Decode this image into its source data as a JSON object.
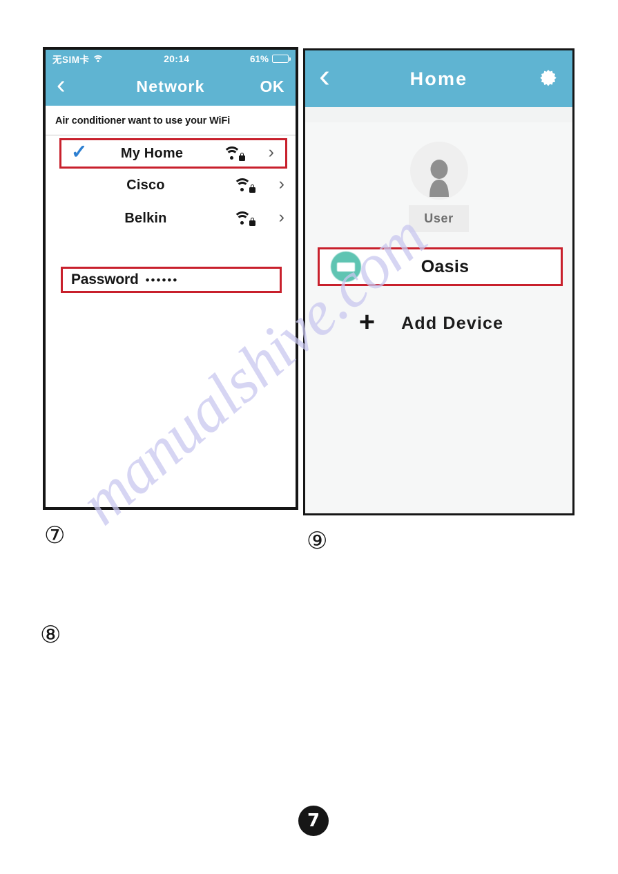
{
  "watermark": {
    "text": "manualshive.com"
  },
  "colors": {
    "header_blue": "#5FB4D2",
    "highlight_red": "#C8202C",
    "check_blue": "#2D7FD1",
    "device_teal": "#5FC4B2",
    "battery_green": "#3FBD46"
  },
  "left_phone": {
    "status_bar": {
      "carrier": "无SIM卡",
      "wifi_icon": "wifi-icon",
      "time": "20:14",
      "battery_percent": "61%",
      "battery_level": 61,
      "battery_icon": "battery-icon"
    },
    "nav": {
      "back_icon": "chevron-left-icon",
      "title": "Network",
      "action_label": "OK"
    },
    "prompt": "Air conditioner want to use your WiFi",
    "networks": [
      {
        "name": "My Home",
        "selected": true,
        "check_icon": "check-icon",
        "signal_icon": "wifi-lock-icon",
        "chevron_icon": "chevron-right-icon",
        "highlighted": true
      },
      {
        "name": "Cisco",
        "selected": false,
        "check_icon": "",
        "signal_icon": "wifi-lock-icon",
        "chevron_icon": "chevron-right-icon",
        "highlighted": false
      },
      {
        "name": "Belkin",
        "selected": false,
        "check_icon": "",
        "signal_icon": "wifi-lock-icon",
        "chevron_icon": "chevron-right-icon",
        "highlighted": false
      }
    ],
    "password_field": {
      "label": "Password",
      "masked_value": "••••••",
      "placeholder": "Password",
      "highlighted": true
    }
  },
  "right_phone": {
    "nav": {
      "back_icon": "chevron-left-icon",
      "title": "Home",
      "settings_icon": "gear-icon"
    },
    "profile": {
      "avatar_icon": "user-avatar-icon",
      "name": "User"
    },
    "devices": [
      {
        "name": "Oasis",
        "icon": "air-conditioner-icon",
        "highlighted": true
      }
    ],
    "add_device": {
      "plus_icon": "plus-icon",
      "label": "Add Device"
    }
  },
  "step_markers": {
    "left_phone": "⑦",
    "right_phone": "⑨",
    "lower_left": "⑧"
  },
  "page_number": "7"
}
